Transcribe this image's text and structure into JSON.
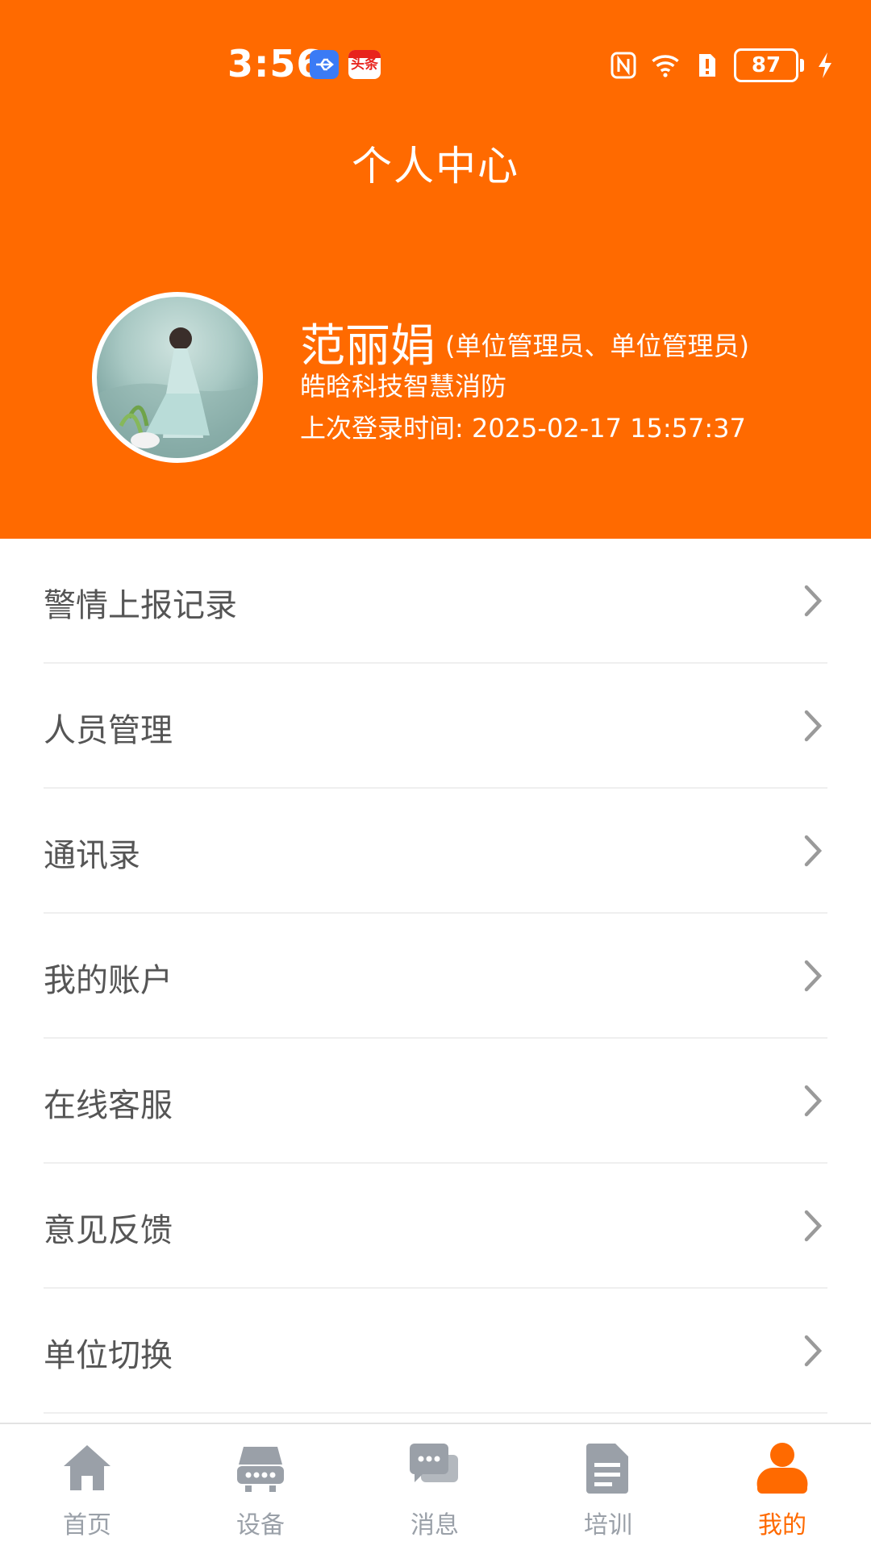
{
  "status_bar": {
    "time": "3:56",
    "news_badge": "头条",
    "battery": "87"
  },
  "header": {
    "title": "个人中心"
  },
  "profile": {
    "name": "范丽娟",
    "roles": "(单位管理员、单位管理员)",
    "org": "皓晗科技智慧消防",
    "last_login": "上次登录时间: 2025-02-17 15:57:37"
  },
  "menu": {
    "items": [
      {
        "label": "警情上报记录"
      },
      {
        "label": "人员管理"
      },
      {
        "label": "通讯录"
      },
      {
        "label": "我的账户"
      },
      {
        "label": "在线客服"
      },
      {
        "label": "意见反馈"
      },
      {
        "label": "单位切换"
      }
    ]
  },
  "tabbar": {
    "tabs": [
      {
        "label": "首页",
        "icon": "home-icon"
      },
      {
        "label": "设备",
        "icon": "device-icon"
      },
      {
        "label": "消息",
        "icon": "message-icon"
      },
      {
        "label": "培训",
        "icon": "training-icon"
      },
      {
        "label": "我的",
        "icon": "profile-icon"
      }
    ],
    "active": "我的"
  },
  "colors": {
    "accent": "#FF6A00",
    "inactive": "#9AA0A8"
  }
}
